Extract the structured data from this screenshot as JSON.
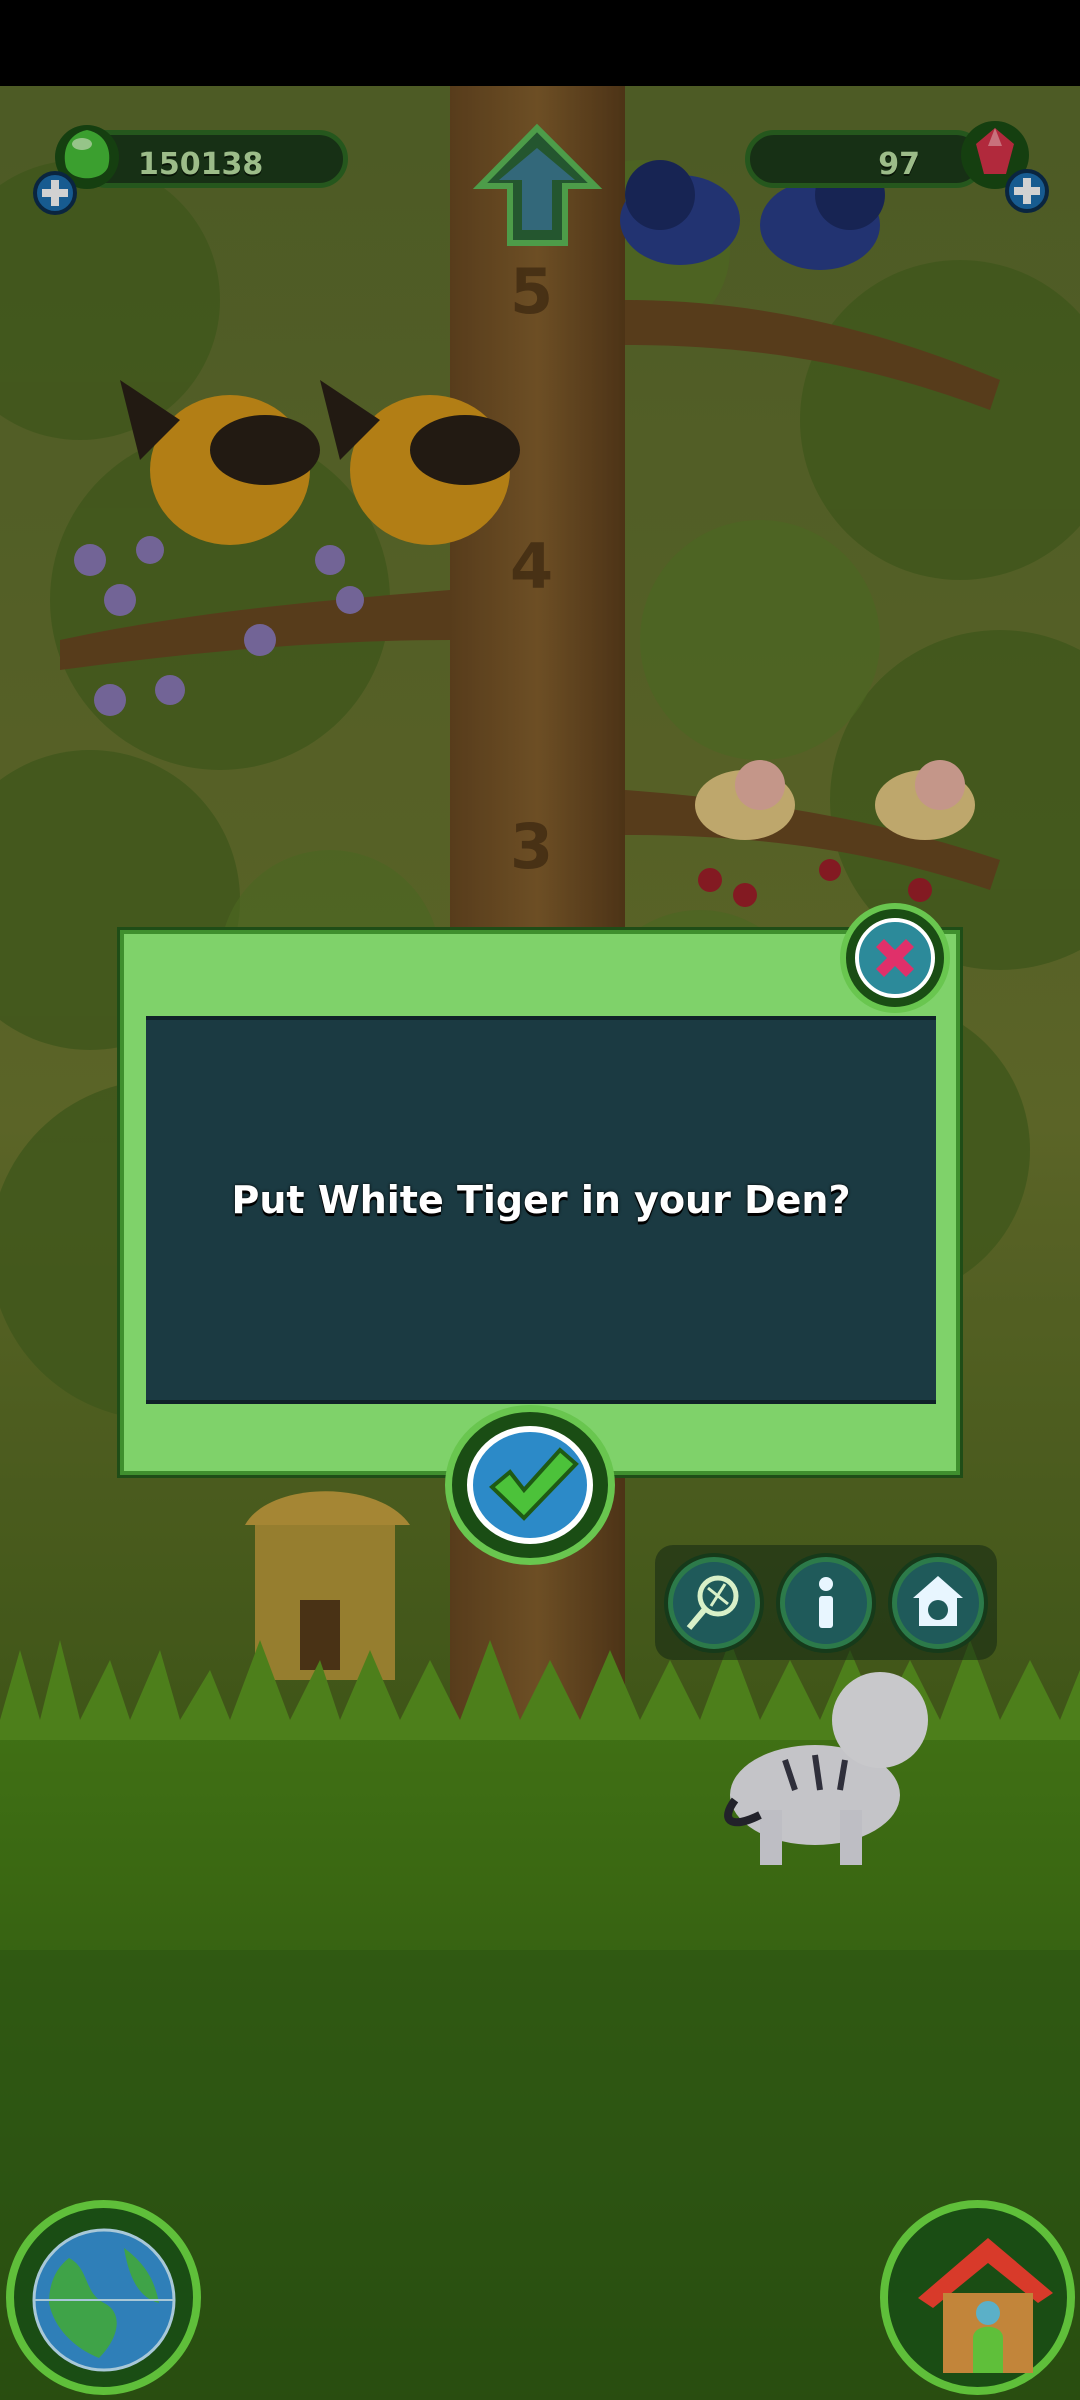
{
  "hud": {
    "coins": "150138",
    "gems": "97"
  },
  "tree_levels": [
    "5",
    "4",
    "3"
  ],
  "dialog": {
    "message": "Put White Tiger in your Den?"
  },
  "icons": {
    "coin": "green-gem-coin-icon",
    "gem": "red-crystal-icon",
    "add": "plus-icon",
    "up": "up-arrow-icon",
    "close": "close-x-icon",
    "confirm": "checkmark-icon",
    "net": "net-icon",
    "info": "info-icon",
    "den": "den-icon",
    "globe": "globe-icon",
    "house": "house-icon"
  },
  "colors": {
    "dialog_frame": "#7fd26a",
    "dialog_panel": "#1b3a42",
    "accent": "#3f8f2e",
    "close": "#e0306a",
    "confirm": "#4cc23a"
  }
}
